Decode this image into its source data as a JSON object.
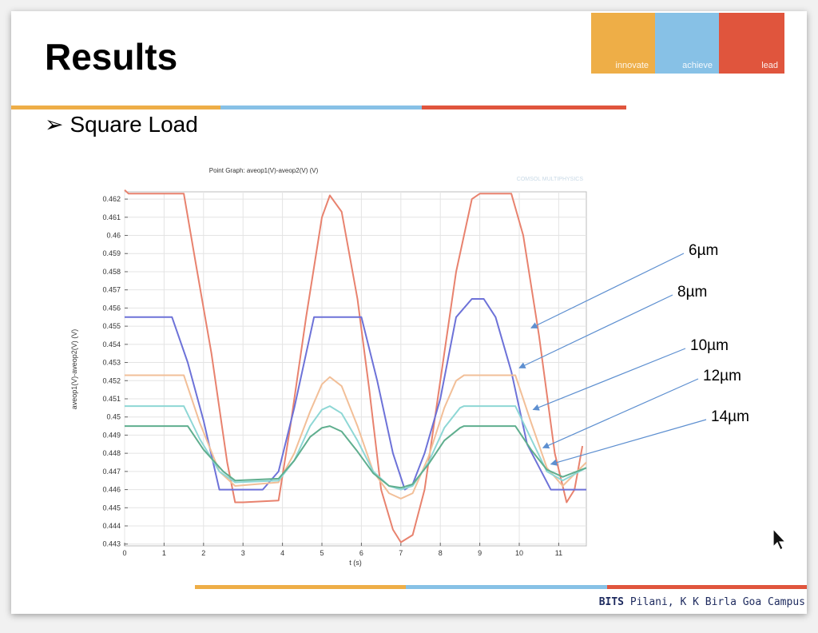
{
  "slide": {
    "title": "Results",
    "bullet_symbol": "➢",
    "bullet_text": "Square Load",
    "footer_brand": "BITS",
    "footer_rest": " Pilani, K K Birla Goa Campus"
  },
  "brand": {
    "labels": [
      "innovate",
      "achieve",
      "lead"
    ],
    "colors": {
      "orange": "#eeae47",
      "blue": "#87c1e6",
      "red": "#e0553d"
    }
  },
  "chart_data": {
    "type": "line",
    "title": "Point Graph: aveop1(V)-aveop2(V) (V)",
    "watermark": "COMSOL MULTIPHYSICS",
    "xlabel": "t (s)",
    "ylabel": "aveop1(V)-aveop2(V) (V)",
    "xlim": [
      0,
      11.7
    ],
    "ylim": [
      0.4429,
      0.4624
    ],
    "x_ticks": [
      0,
      1,
      2,
      3,
      4,
      5,
      6,
      7,
      8,
      9,
      10,
      11
    ],
    "y_ticks": [
      0.443,
      0.444,
      0.445,
      0.446,
      0.447,
      0.448,
      0.449,
      0.45,
      0.451,
      0.452,
      0.453,
      0.454,
      0.455,
      0.456,
      0.457,
      0.458,
      0.459,
      0.46,
      0.461,
      0.462
    ],
    "y_tick_labels": [
      "0.443",
      "0.444",
      "0.445",
      "0.446",
      "0.447",
      "0.448",
      "0.449",
      "0.45",
      "0.451",
      "0.452",
      "0.453",
      "0.454",
      "0.455",
      "0.456",
      "0.457",
      "0.458",
      "0.459",
      "0.46",
      "0.461",
      "0.462"
    ],
    "grid": true,
    "series": [
      {
        "name": "6µm",
        "color": "#e8826e",
        "points": [
          [
            0,
            0.4625
          ],
          [
            0.1,
            0.4623
          ],
          [
            1.5,
            0.4623
          ],
          [
            1.8,
            0.4585
          ],
          [
            2.2,
            0.4535
          ],
          [
            2.6,
            0.4475
          ],
          [
            2.8,
            0.4453
          ],
          [
            3.0,
            0.4453
          ],
          [
            3.9,
            0.4454
          ],
          [
            4.2,
            0.4495
          ],
          [
            4.6,
            0.4555
          ],
          [
            5.0,
            0.461
          ],
          [
            5.2,
            0.4622
          ],
          [
            5.5,
            0.4613
          ],
          [
            5.9,
            0.4565
          ],
          [
            6.2,
            0.4515
          ],
          [
            6.5,
            0.446
          ],
          [
            6.8,
            0.4438
          ],
          [
            7.0,
            0.4431
          ],
          [
            7.3,
            0.4435
          ],
          [
            7.6,
            0.446
          ],
          [
            8.0,
            0.452
          ],
          [
            8.4,
            0.458
          ],
          [
            8.8,
            0.462
          ],
          [
            9.0,
            0.4623
          ],
          [
            9.8,
            0.4623
          ],
          [
            10.1,
            0.46
          ],
          [
            10.5,
            0.4545
          ],
          [
            10.9,
            0.448
          ],
          [
            11.2,
            0.4453
          ],
          [
            11.4,
            0.446
          ],
          [
            11.6,
            0.4484
          ]
        ]
      },
      {
        "name": "8µm",
        "color": "#6d72d8",
        "points": [
          [
            0,
            0.4555
          ],
          [
            1.2,
            0.4555
          ],
          [
            1.6,
            0.453
          ],
          [
            2.0,
            0.4498
          ],
          [
            2.4,
            0.446
          ],
          [
            3.5,
            0.446
          ],
          [
            3.9,
            0.447
          ],
          [
            4.3,
            0.4505
          ],
          [
            4.8,
            0.4555
          ],
          [
            6.0,
            0.4555
          ],
          [
            6.4,
            0.452
          ],
          [
            6.8,
            0.448
          ],
          [
            7.1,
            0.446
          ],
          [
            7.3,
            0.4463
          ],
          [
            7.6,
            0.448
          ],
          [
            8.0,
            0.451
          ],
          [
            8.4,
            0.4555
          ],
          [
            8.8,
            0.4565
          ],
          [
            9.1,
            0.4565
          ],
          [
            9.4,
            0.4555
          ],
          [
            9.8,
            0.4525
          ],
          [
            10.2,
            0.4485
          ],
          [
            10.8,
            0.446
          ],
          [
            11.7,
            0.446
          ]
        ]
      },
      {
        "name": "10µm",
        "color": "#f2bf98",
        "points": [
          [
            0,
            0.4523
          ],
          [
            1.5,
            0.4523
          ],
          [
            1.9,
            0.4497
          ],
          [
            2.4,
            0.447
          ],
          [
            2.8,
            0.4462
          ],
          [
            3.9,
            0.4464
          ],
          [
            4.3,
            0.448
          ],
          [
            4.7,
            0.4503
          ],
          [
            5.0,
            0.4518
          ],
          [
            5.2,
            0.4522
          ],
          [
            5.5,
            0.4517
          ],
          [
            5.9,
            0.4495
          ],
          [
            6.3,
            0.447
          ],
          [
            6.7,
            0.4458
          ],
          [
            7.0,
            0.4455
          ],
          [
            7.3,
            0.4458
          ],
          [
            7.7,
            0.4478
          ],
          [
            8.1,
            0.4505
          ],
          [
            8.4,
            0.452
          ],
          [
            8.6,
            0.4523
          ],
          [
            9.9,
            0.4523
          ],
          [
            10.3,
            0.4497
          ],
          [
            10.7,
            0.4472
          ],
          [
            11.1,
            0.4462
          ],
          [
            11.7,
            0.4475
          ]
        ]
      },
      {
        "name": "12µm",
        "color": "#8ed7d5",
        "points": [
          [
            0,
            0.4506
          ],
          [
            1.5,
            0.4506
          ],
          [
            1.9,
            0.4488
          ],
          [
            2.4,
            0.447
          ],
          [
            2.8,
            0.4464
          ],
          [
            3.9,
            0.4465
          ],
          [
            4.3,
            0.4476
          ],
          [
            4.7,
            0.4495
          ],
          [
            5.0,
            0.4504
          ],
          [
            5.2,
            0.4506
          ],
          [
            5.5,
            0.4502
          ],
          [
            5.9,
            0.4487
          ],
          [
            6.3,
            0.447
          ],
          [
            6.7,
            0.4462
          ],
          [
            7.0,
            0.446
          ],
          [
            7.3,
            0.4462
          ],
          [
            7.7,
            0.4475
          ],
          [
            8.1,
            0.4494
          ],
          [
            8.5,
            0.4505
          ],
          [
            8.6,
            0.4506
          ],
          [
            9.9,
            0.4506
          ],
          [
            10.3,
            0.4488
          ],
          [
            10.7,
            0.447
          ],
          [
            11.1,
            0.4465
          ],
          [
            11.7,
            0.4472
          ]
        ]
      },
      {
        "name": "14µm",
        "color": "#5fae8e",
        "points": [
          [
            0,
            0.4495
          ],
          [
            1.6,
            0.4495
          ],
          [
            2.0,
            0.4482
          ],
          [
            2.5,
            0.447
          ],
          [
            2.8,
            0.4465
          ],
          [
            3.9,
            0.4466
          ],
          [
            4.3,
            0.4476
          ],
          [
            4.7,
            0.4489
          ],
          [
            5.0,
            0.4494
          ],
          [
            5.2,
            0.4495
          ],
          [
            5.5,
            0.4492
          ],
          [
            5.9,
            0.4481
          ],
          [
            6.3,
            0.4469
          ],
          [
            6.7,
            0.4462
          ],
          [
            7.0,
            0.4461
          ],
          [
            7.3,
            0.4463
          ],
          [
            7.7,
            0.4474
          ],
          [
            8.1,
            0.4487
          ],
          [
            8.5,
            0.4494
          ],
          [
            8.6,
            0.4495
          ],
          [
            9.9,
            0.4495
          ],
          [
            10.3,
            0.4482
          ],
          [
            10.7,
            0.4471
          ],
          [
            11.1,
            0.4467
          ],
          [
            11.7,
            0.4472
          ]
        ]
      }
    ],
    "annotations": [
      {
        "label": "6µm",
        "target": [
          10.3,
          0.4549
        ]
      },
      {
        "label": "8µm",
        "target": [
          10.0,
          0.4527
        ]
      },
      {
        "label": "10µm",
        "target": [
          10.35,
          0.4504
        ]
      },
      {
        "label": "12µm",
        "target": [
          10.6,
          0.4483
        ]
      },
      {
        "label": "14µm",
        "target": [
          10.8,
          0.4474
        ]
      }
    ]
  }
}
